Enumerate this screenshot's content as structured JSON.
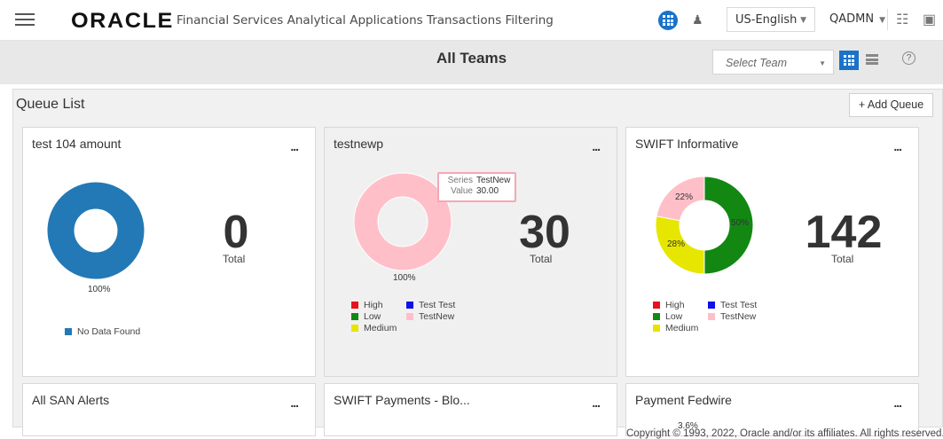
{
  "header": {
    "logo": "ORACLE",
    "app_title": "Financial Services Analytical Applications Transactions Filtering",
    "language": "US-English",
    "user": "QADMN"
  },
  "subheader": {
    "title": "All Teams",
    "team_select_placeholder": "Select Team",
    "help_label": "?"
  },
  "queue_list": {
    "title": "Queue List",
    "add_button": "+ Add Queue",
    "more_label": "...",
    "total_label": "Total"
  },
  "cards": [
    {
      "title": "test 104 amount",
      "total": "0",
      "slices": [
        {
          "label": "No Data Found",
          "percent": 100,
          "color": "#2379b5"
        }
      ],
      "pct_labels": [
        "100%"
      ],
      "legend": [
        {
          "label": "No Data Found",
          "color": "#2379b5"
        }
      ]
    },
    {
      "title": "testnewp",
      "total": "30",
      "slices": [
        {
          "label": "TestNew",
          "percent": 100,
          "color": "#ffbfc9"
        }
      ],
      "pct_labels": [
        "100%"
      ],
      "legend": [
        {
          "label": "High",
          "color": "#e8121e"
        },
        {
          "label": "Test Test",
          "color": "#1010e8"
        },
        {
          "label": "Low",
          "color": "#138813"
        },
        {
          "label": "TestNew",
          "color": "#ffbfc9"
        },
        {
          "label": "Medium",
          "color": "#e8e400"
        }
      ],
      "tooltip": {
        "series_key": "Series",
        "series_val": "TestNew",
        "value_key": "Value",
        "value_val": "30.00"
      }
    },
    {
      "title": "SWIFT Informative",
      "total": "142",
      "slices": [
        {
          "label": "Low",
          "percent": 50,
          "color": "#128812"
        },
        {
          "label": "Medium",
          "percent": 28,
          "color": "#e6e600"
        },
        {
          "label": "TestNew",
          "percent": 22,
          "color": "#ffbfc9"
        }
      ],
      "pct_labels": [
        "50%",
        "28%",
        "22%"
      ],
      "legend": [
        {
          "label": "High",
          "color": "#e8121e"
        },
        {
          "label": "Test Test",
          "color": "#1010e8"
        },
        {
          "label": "Low",
          "color": "#138813"
        },
        {
          "label": "TestNew",
          "color": "#ffbfc9"
        },
        {
          "label": "Medium",
          "color": "#e8e400"
        }
      ]
    },
    {
      "title": "All SAN Alerts"
    },
    {
      "title": "SWIFT Payments - Blo..."
    },
    {
      "title": "Payment Fedwire",
      "partial_pct": "3.6%"
    }
  ],
  "footer": {
    "copyright": "Copyright © 1993, 2022, Oracle and/or its affiliates. All rights reserved."
  }
}
